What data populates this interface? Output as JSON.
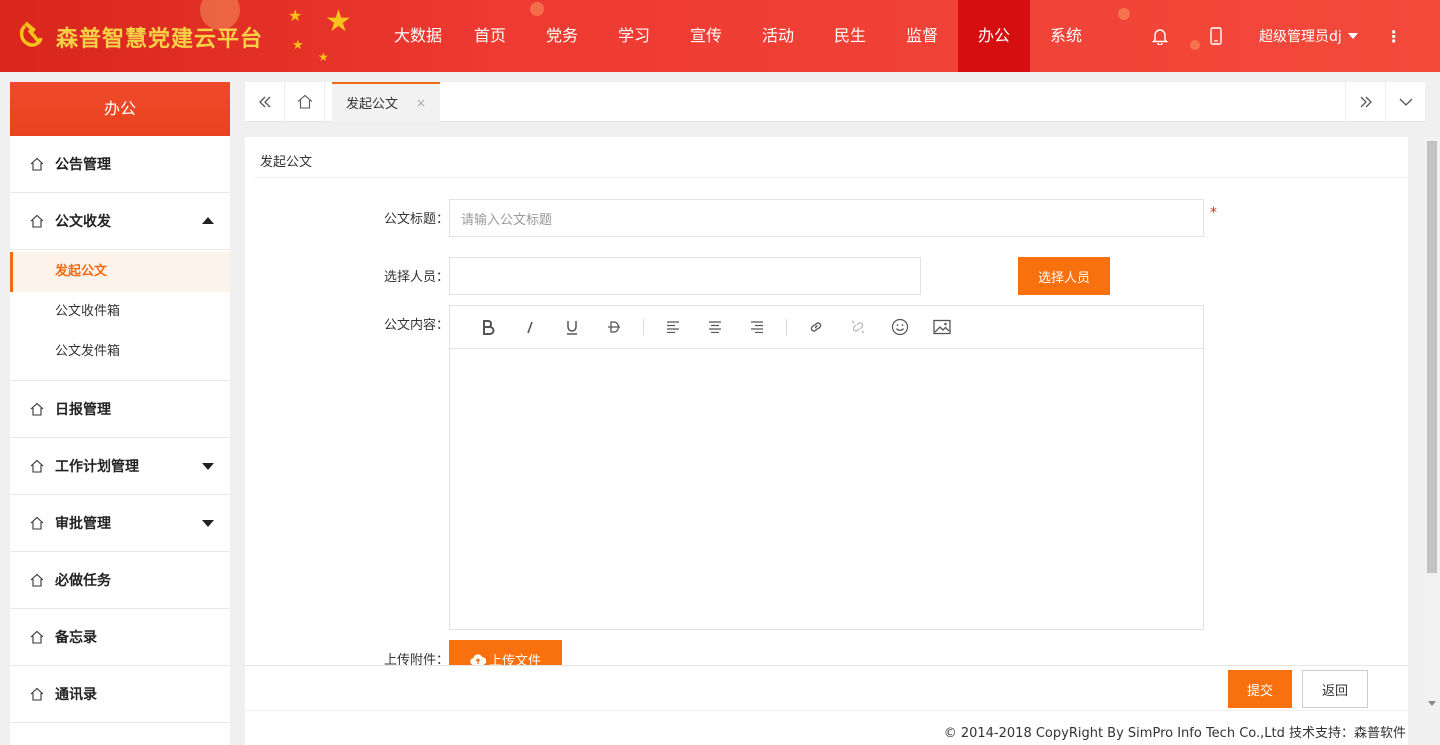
{
  "app": {
    "title": "森普智慧党建云平台",
    "accent": "#f9700f",
    "header_red": "#e8312b",
    "logo_icon": "hammer-sickle-icon"
  },
  "nav": {
    "items": [
      {
        "label": "大数据"
      },
      {
        "label": "首页"
      },
      {
        "label": "党务"
      },
      {
        "label": "学习"
      },
      {
        "label": "宣传"
      },
      {
        "label": "活动"
      },
      {
        "label": "民生"
      },
      {
        "label": "监督"
      },
      {
        "label": "办公",
        "active": true
      },
      {
        "label": "系统"
      }
    ]
  },
  "header_right": {
    "bell_icon": "bell-icon",
    "phone_icon": "mobile-icon",
    "user": "超级管理员dj",
    "more_icon": "⋮"
  },
  "sidebar": {
    "title": "办公",
    "items": [
      {
        "label": "公告管理"
      },
      {
        "label": "公文收发",
        "expanded": true
      },
      {
        "label": "日报管理"
      },
      {
        "label": "工作计划管理",
        "has_children": true
      },
      {
        "label": "审批管理",
        "has_children": true
      },
      {
        "label": "必做任务"
      },
      {
        "label": "备忘录"
      },
      {
        "label": "通讯录"
      }
    ],
    "sub_items": [
      {
        "label": "发起公文",
        "active": true
      },
      {
        "label": "公文收件箱"
      },
      {
        "label": "公文发件箱"
      }
    ]
  },
  "tabs": {
    "items": [
      {
        "label": "发起公文",
        "close": "×"
      }
    ]
  },
  "form": {
    "heading": "发起公文",
    "title_label": "公文标题：",
    "title_placeholder": "请输入公文标题",
    "required_mark": "*",
    "person_label": "选择人员：",
    "person_value": "",
    "person_button": "选择人员",
    "content_label": "公文内容：",
    "attach_label": "上传附件：",
    "upload_button": "上传文件",
    "submit_button": "提交",
    "back_button": "返回"
  },
  "editor_toolbar": [
    "bold-icon",
    "italic-icon",
    "underline-icon",
    "strikethrough-icon",
    "align-left-icon",
    "align-center-icon",
    "align-right-icon",
    "link-icon",
    "unlink-icon",
    "emoji-icon",
    "image-icon"
  ],
  "footer": {
    "text": "© 2014-2018 CopyRight By SimPro Info Tech Co.,Ltd 技术支持：森普软件"
  }
}
